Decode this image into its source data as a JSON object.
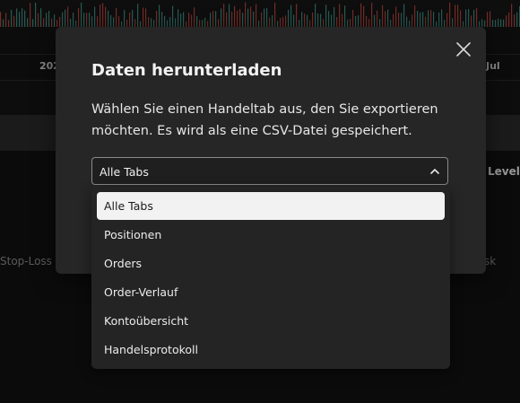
{
  "background": {
    "axis_labels": [
      "202",
      "Jul"
    ],
    "column_right": "Level",
    "left_text": "Stop-Loss",
    "right_text": "sk"
  },
  "modal": {
    "title": "Daten herunterladen",
    "description": "Wählen Sie einen Handeltab aus, den Sie exportieren möchten. Es wird als eine CSV-Datei gespeichert.",
    "select": {
      "value": "Alle Tabs",
      "options": [
        "Alle Tabs",
        "Positionen",
        "Orders",
        "Order-Verlauf",
        "Kontoübersicht",
        "Handelsprotokoll"
      ]
    }
  },
  "colors": {
    "modal_bg": "#262626",
    "selected_option_bg": "#f2f2f2",
    "chart_red": "#b0443c",
    "chart_teal": "#3f8a80"
  }
}
